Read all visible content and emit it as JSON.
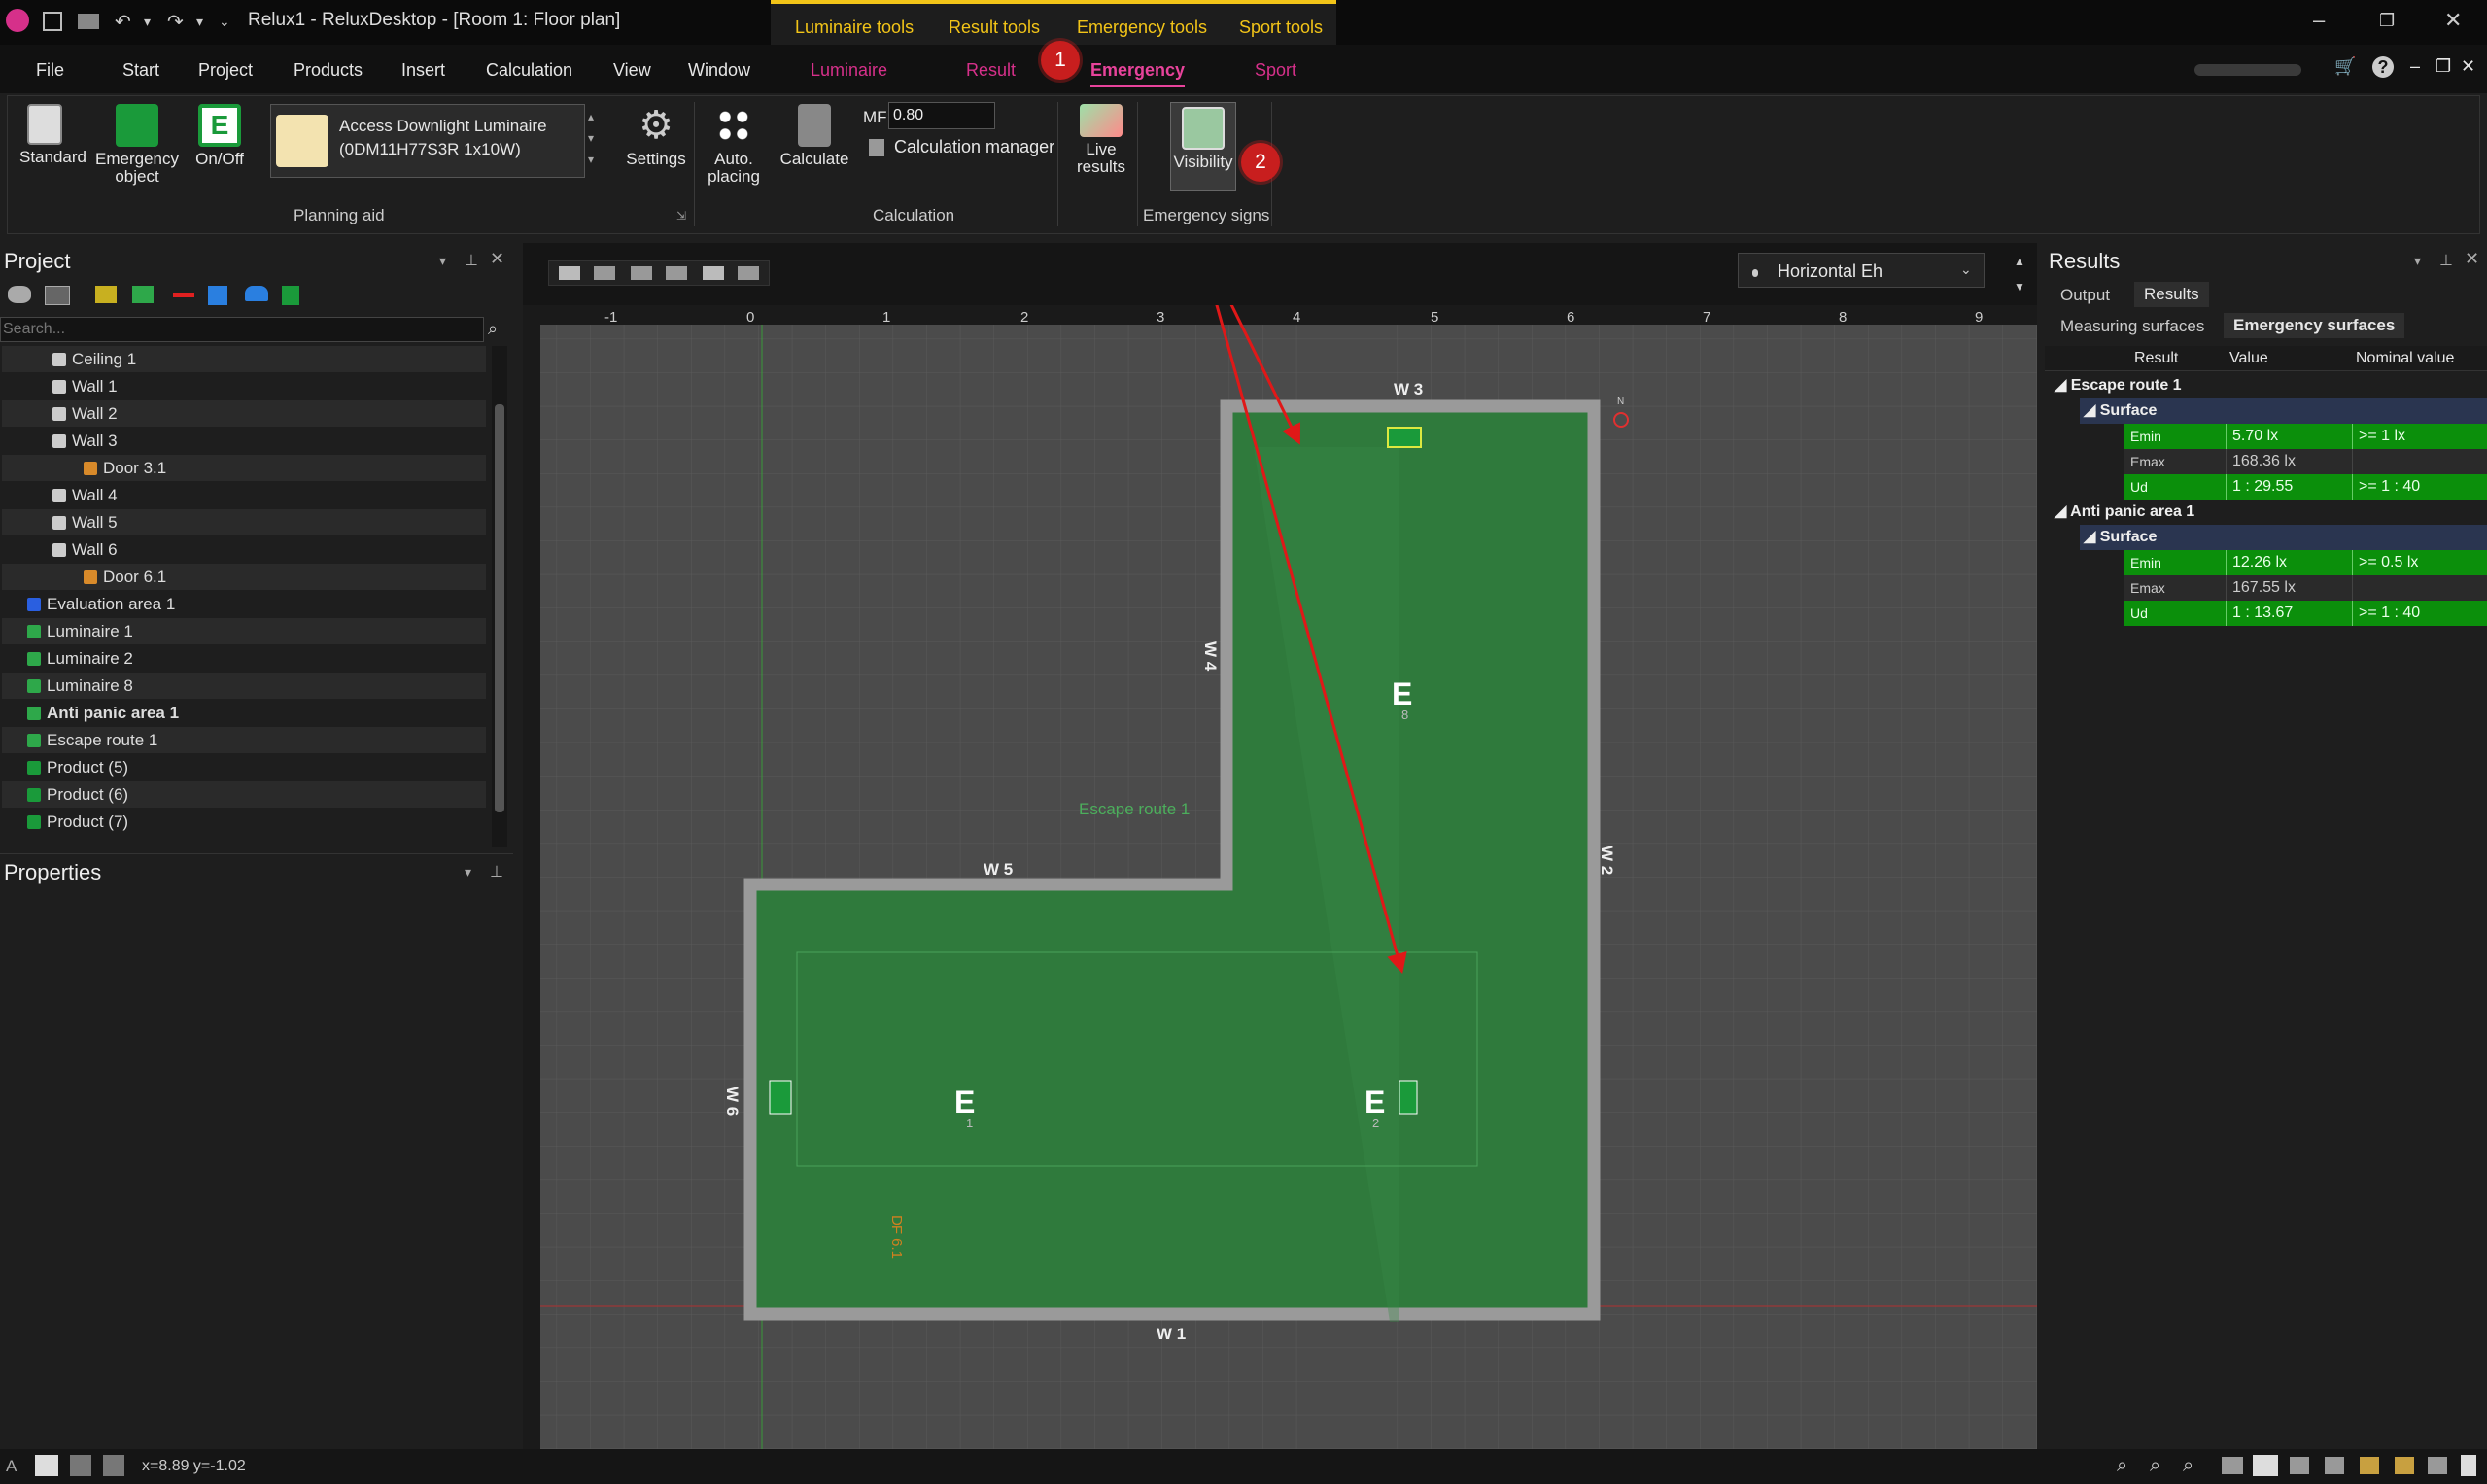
{
  "window": {
    "title": "Relux1 - ReluxDesktop - [Room 1: Floor plan]",
    "context_tabs": [
      "Luminaire tools",
      "Result tools",
      "Emergency tools",
      "Sport tools"
    ]
  },
  "menu": {
    "items": [
      "File",
      "Start",
      "Project",
      "Products",
      "Insert",
      "Calculation",
      "View",
      "Window"
    ],
    "context": [
      "Luminaire",
      "Result",
      "Emergency",
      "Sport"
    ],
    "active": "Emergency"
  },
  "ribbon": {
    "planning": {
      "standard": "Standard",
      "emergency_object": "Emergency object",
      "onoff": "On/Off",
      "luminaire_line1": "Access Downlight Luminaire",
      "luminaire_line2": "(0DM11H77S3R 1x10W)",
      "settings": "Settings",
      "group": "Planning aid"
    },
    "calculation": {
      "auto_placing": "Auto. placing",
      "calculate": "Calculate",
      "mf_label": "MF",
      "mf_value": "0.80",
      "calc_manager": "Calculation manager",
      "live_results": "Live results",
      "group": "Calculation"
    },
    "emergency_signs": {
      "visibility": "Visibility",
      "group": "Emergency signs"
    }
  },
  "badges": [
    "1",
    "2"
  ],
  "project": {
    "title": "Project",
    "search_placeholder": "Search...",
    "tree": [
      "Ceiling 1",
      "Wall 1",
      "Wall 2",
      "Wall 3",
      "Door 3.1",
      "Wall 4",
      "Wall 5",
      "Wall 6",
      "Door 6.1",
      "Evaluation area 1",
      "Luminaire  1",
      "Luminaire  2",
      "Luminaire  8",
      "Anti panic area 1",
      "Escape route 1",
      "Product (5)",
      "Product (6)",
      "Product (7)"
    ]
  },
  "properties": {
    "title": "Properties"
  },
  "view": {
    "mode": "Horizontal Eh",
    "ruler_x": [
      "-1",
      "0",
      "1",
      "2",
      "3",
      "4",
      "5",
      "6",
      "7",
      "8",
      "9"
    ],
    "walls": [
      "W 1",
      "W 2",
      "W 3",
      "W 4",
      "W 5",
      "W 6"
    ],
    "labels": {
      "escape": "Escape route 1",
      "door": "DF 6.1",
      "lum8": "8",
      "lum1": "1",
      "lum2": "2",
      "compass": "N"
    }
  },
  "results": {
    "title": "Results",
    "tabs": [
      "Output",
      "Results"
    ],
    "subtabs": [
      "Measuring surfaces",
      "Emergency surfaces"
    ],
    "columns": [
      "Result",
      "Value",
      "Nominal value"
    ],
    "groups": [
      {
        "name": "Escape route 1",
        "surface": "Surface",
        "rows": [
          [
            "Emin",
            "5.70 lx",
            ">= 1 lx"
          ],
          [
            "Emax",
            "168.36 lx",
            ""
          ],
          [
            "Ud",
            "1 : 29.55",
            ">= 1 : 40"
          ]
        ]
      },
      {
        "name": "Anti panic area 1",
        "surface": "Surface",
        "rows": [
          [
            "Emin",
            "12.26 lx",
            ">= 0.5 lx"
          ],
          [
            "Emax",
            "167.55 lx",
            ""
          ],
          [
            "Ud",
            "1 : 13.67",
            ">= 1 : 40"
          ]
        ]
      }
    ]
  },
  "status": {
    "coords": "x=8.89 y=-1.02"
  },
  "colors": {
    "accent": "#e8439b",
    "ctx": "#f2c418",
    "room": "#2f7a3c",
    "good": "#0b8f0b",
    "arrow": "#e01818"
  }
}
